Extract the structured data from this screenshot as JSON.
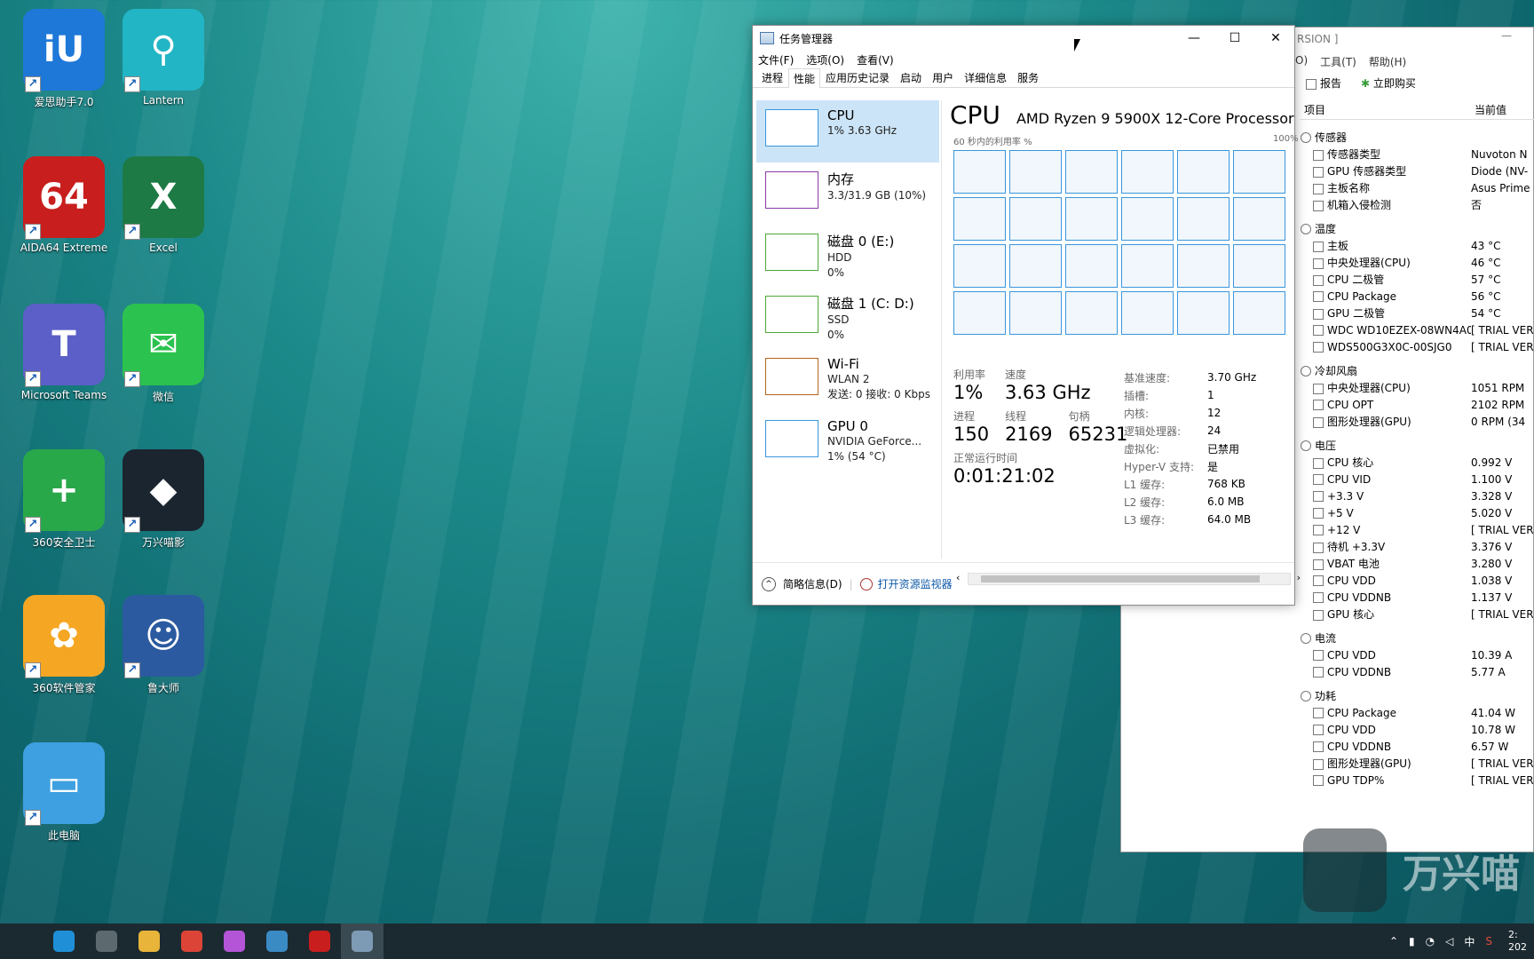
{
  "desktop": {
    "icons": [
      {
        "label": "爱思助手7.0",
        "glyph": "iU",
        "color": "#1e78d8"
      },
      {
        "label": "Lantern",
        "glyph": "⚲",
        "color": "#22b5c5"
      },
      {
        "label": "AIDA64 Extreme",
        "glyph": "64",
        "color": "#c81e1e"
      },
      {
        "label": "Excel",
        "glyph": "X",
        "color": "#1d7a45"
      },
      {
        "label": "Microsoft Teams",
        "glyph": "T",
        "color": "#5b5fc7"
      },
      {
        "label": "微信",
        "glyph": "✉",
        "color": "#2cc24f"
      },
      {
        "label": "360安全卫士",
        "glyph": "+",
        "color": "#29a84a"
      },
      {
        "label": "万兴喵影",
        "glyph": "◆",
        "color": "#1b2530"
      },
      {
        "label": "360软件管家",
        "glyph": "✿",
        "color": "#f5a623"
      },
      {
        "label": "鲁大师",
        "glyph": "☺",
        "color": "#2b5aa0"
      },
      {
        "label": "此电脑",
        "glyph": "▭",
        "color": "#3ea0e0"
      }
    ]
  },
  "task_manager": {
    "title": "任务管理器",
    "controls": {
      "minimize": "—",
      "maximize": "☐",
      "close": "✕"
    },
    "menu": [
      "文件(F)",
      "选项(O)",
      "查看(V)"
    ],
    "tabs": [
      "进程",
      "性能",
      "应用历史记录",
      "启动",
      "用户",
      "详细信息",
      "服务"
    ],
    "active_tab": "性能",
    "sidebar": [
      {
        "name": "CPU",
        "line1": "1% 3.63 GHz",
        "line2": ""
      },
      {
        "name": "内存",
        "line1": "3.3/31.9 GB (10%)",
        "line2": ""
      },
      {
        "name": "磁盘 0 (E:)",
        "line1": "HDD",
        "line2": "0%"
      },
      {
        "name": "磁盘 1 (C: D:)",
        "line1": "SSD",
        "line2": "0%"
      },
      {
        "name": "Wi-Fi",
        "line1": "WLAN 2",
        "line2": "发送: 0 接收: 0 Kbps"
      },
      {
        "name": "GPU 0",
        "line1": "NVIDIA GeForce...",
        "line2": "1% (54 °C)"
      }
    ],
    "panel": {
      "title": "CPU",
      "model": "AMD Ryzen 9 5900X 12-Core Processor",
      "graph_label": "60 秒内的利用率 %",
      "graph_max": "100%",
      "util_label": "利用率",
      "util": "1%",
      "speed_label": "速度",
      "speed": "3.63 GHz",
      "proc_label": "进程",
      "proc": "150",
      "thread_label": "线程",
      "thread": "2169",
      "handle_label": "句柄",
      "handle": "65231",
      "uptime_label": "正常运行时间",
      "uptime": "0:01:21:02",
      "specs": [
        {
          "k": "基准速度:",
          "v": "3.70 GHz"
        },
        {
          "k": "插槽:",
          "v": "1"
        },
        {
          "k": "内核:",
          "v": "12"
        },
        {
          "k": "逻辑处理器:",
          "v": "24"
        },
        {
          "k": "虚拟化:",
          "v": "已禁用"
        },
        {
          "k": "Hyper-V 支持:",
          "v": "是"
        },
        {
          "k": "L1 缓存:",
          "v": "768 KB"
        },
        {
          "k": "L2 缓存:",
          "v": "6.0 MB"
        },
        {
          "k": "L3 缓存:",
          "v": "64.0 MB"
        }
      ]
    },
    "footer": {
      "less": "简略信息(D)",
      "monitor": "打开资源监视器"
    }
  },
  "aida": {
    "title_fragment": "RSION ]",
    "menu": [
      "O)",
      "工具(T)",
      "帮助(H)"
    ],
    "toolbar": {
      "report": "报告",
      "buy": "立即购买"
    },
    "col_item": "项目",
    "col_value": "当前值",
    "sections": [
      {
        "name": "传感器",
        "rows": [
          {
            "n": "传感器类型",
            "v": "Nuvoton N"
          },
          {
            "n": "GPU 传感器类型",
            "v": "Diode (NV-"
          },
          {
            "n": "主板名称",
            "v": "Asus Prime"
          },
          {
            "n": "机箱入侵检测",
            "v": "否"
          }
        ]
      },
      {
        "name": "温度",
        "rows": [
          {
            "n": "主板",
            "v": "43 °C"
          },
          {
            "n": "中央处理器(CPU)",
            "v": "46 °C"
          },
          {
            "n": "CPU 二极管",
            "v": "57 °C"
          },
          {
            "n": "CPU Package",
            "v": "56 °C"
          },
          {
            "n": "GPU 二极管",
            "v": "54 °C"
          },
          {
            "n": "WDC WD10EZEX-08WN4A0",
            "v": "[ TRIAL VER"
          },
          {
            "n": "WDS500G3X0C-00SJG0",
            "v": "[ TRIAL VER"
          }
        ]
      },
      {
        "name": "冷却风扇",
        "rows": [
          {
            "n": "中央处理器(CPU)",
            "v": "1051 RPM"
          },
          {
            "n": "CPU OPT",
            "v": "2102 RPM"
          },
          {
            "n": "图形处理器(GPU)",
            "v": "0 RPM  (34"
          }
        ]
      },
      {
        "name": "电压",
        "rows": [
          {
            "n": "CPU 核心",
            "v": "0.992 V"
          },
          {
            "n": "CPU VID",
            "v": "1.100 V"
          },
          {
            "n": "+3.3 V",
            "v": "3.328 V"
          },
          {
            "n": "+5 V",
            "v": "5.020 V"
          },
          {
            "n": "+12 V",
            "v": "[ TRIAL VER"
          },
          {
            "n": "待机 +3.3V",
            "v": "3.376 V"
          },
          {
            "n": "VBAT 电池",
            "v": "3.280 V"
          },
          {
            "n": "CPU VDD",
            "v": "1.038 V"
          },
          {
            "n": "CPU VDDNB",
            "v": "1.137 V"
          },
          {
            "n": "GPU 核心",
            "v": "[ TRIAL VER"
          }
        ]
      },
      {
        "name": "电流",
        "rows": [
          {
            "n": "CPU VDD",
            "v": "10.39 A"
          },
          {
            "n": "CPU VDDNB",
            "v": "5.77 A"
          }
        ]
      },
      {
        "name": "功耗",
        "rows": [
          {
            "n": "CPU Package",
            "v": "41.04 W"
          },
          {
            "n": "CPU VDD",
            "v": "10.78 W"
          },
          {
            "n": "CPU VDDNB",
            "v": "6.57 W"
          },
          {
            "n": "图形处理器(GPU)",
            "v": "[ TRIAL VER"
          },
          {
            "n": "GPU TDP%",
            "v": "[ TRIAL VER"
          }
        ]
      }
    ]
  },
  "watermark": "万兴喵",
  "taskbar": {
    "apps": [
      {
        "name": "edge",
        "color": "#1f8fd8"
      },
      {
        "name": "calculator",
        "color": "#5c6a70"
      },
      {
        "name": "file-explorer",
        "color": "#e8b53a"
      },
      {
        "name": "chrome",
        "color": "#db4437"
      },
      {
        "name": "color-app",
        "color": "#b455d8"
      },
      {
        "name": "installer",
        "color": "#3a8ac4"
      },
      {
        "name": "aida64",
        "color": "#c81e1e"
      },
      {
        "name": "task-manager",
        "color": "#7e9bb5"
      }
    ],
    "tray": {
      "ime": "中",
      "clock_top": "2:",
      "clock_bottom": "202"
    }
  }
}
